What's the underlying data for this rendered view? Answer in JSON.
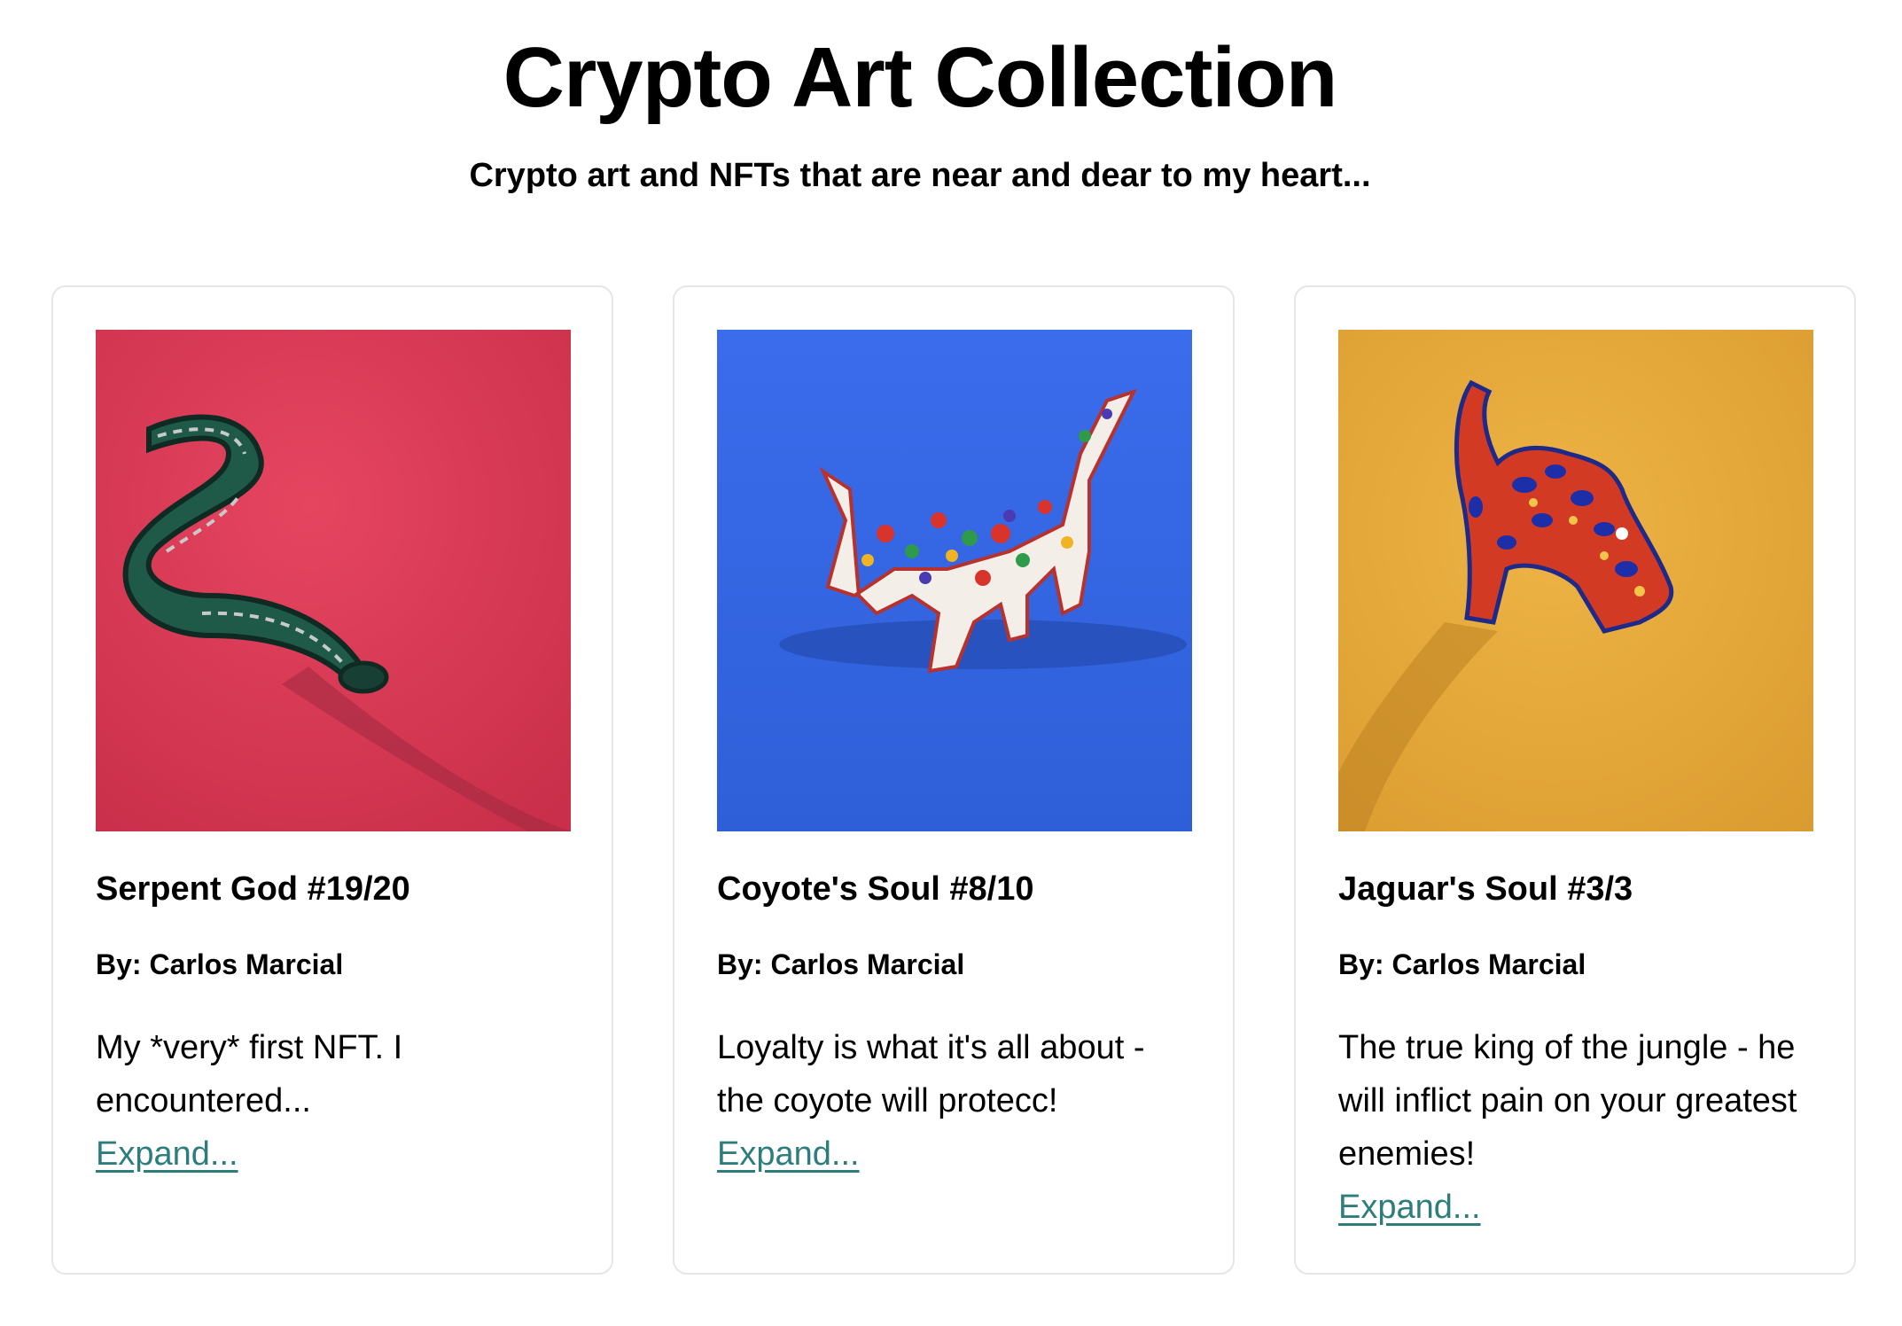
{
  "page": {
    "title": "Crypto Art Collection",
    "subtitle": "Crypto art and NFTs that are near and dear to my heart..."
  },
  "cards": [
    {
      "title": "Serpent God #19/20",
      "author": "By: Carlos Marcial",
      "description": "My *very* first NFT. I encountered...",
      "expand_label": "Expand...",
      "art_icon": "serpent-art",
      "background_color": "#e03a57"
    },
    {
      "title": "Coyote's Soul #8/10",
      "author": "By: Carlos Marcial",
      "description": "Loyalty is what it's all about - the coyote will protecc!",
      "expand_label": "Expand...",
      "art_icon": "coyote-art",
      "background_color": "#3467e6"
    },
    {
      "title": "Jaguar's Soul #3/3",
      "author": "By: Carlos Marcial",
      "description": "The true king of the jungle - he will inflict pain on your greatest enemies!",
      "expand_label": "Expand...",
      "art_icon": "jaguar-art",
      "background_color": "#e8b03f"
    }
  ],
  "colors": {
    "link": "#2e7d7d",
    "card_border": "#e6e6e6"
  }
}
